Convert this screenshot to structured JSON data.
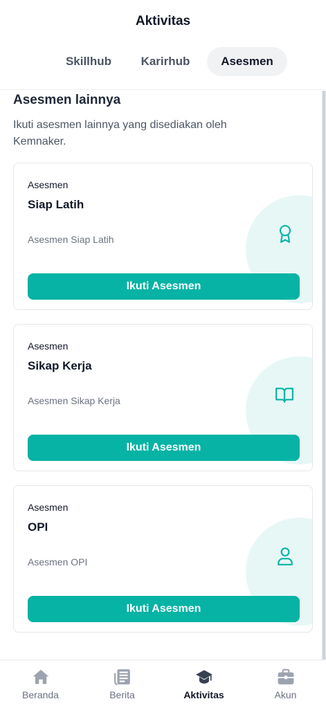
{
  "header": {
    "title": "Aktivitas",
    "tabs": [
      {
        "label": "Skillhub",
        "active": false
      },
      {
        "label": "Karirhub",
        "active": false
      },
      {
        "label": "Asesmen",
        "active": true
      }
    ]
  },
  "section": {
    "title": "Asesmen lainnya",
    "description": "Ikuti asesmen lainnya yang disediakan oleh Kemnaker."
  },
  "cards": [
    {
      "kicker": "Asesmen",
      "name": "Siap Latih",
      "subtitle": "Asesmen Siap Latih",
      "button": "Ikuti Asesmen",
      "icon": "award-icon"
    },
    {
      "kicker": "Asesmen",
      "name": "Sikap Kerja",
      "subtitle": "Asesmen Sikap Kerja",
      "button": "Ikuti Asesmen",
      "icon": "book-open-icon"
    },
    {
      "kicker": "Asesmen",
      "name": "OPI",
      "subtitle": "Asesmen OPI",
      "button": "Ikuti Asesmen",
      "icon": "user-icon"
    }
  ],
  "bottom_nav": [
    {
      "label": "Beranda",
      "icon": "home-icon",
      "active": false
    },
    {
      "label": "Berita",
      "icon": "newspaper-icon",
      "active": false
    },
    {
      "label": "Aktivitas",
      "icon": "graduation-cap-icon",
      "active": true
    },
    {
      "label": "Akun",
      "icon": "briefcase-icon",
      "active": false
    }
  ],
  "colors": {
    "accent": "#06B3A4",
    "accent_light": "#E6F7F6",
    "nav_inactive": "#9CA3AF",
    "nav_active": "#374151"
  }
}
